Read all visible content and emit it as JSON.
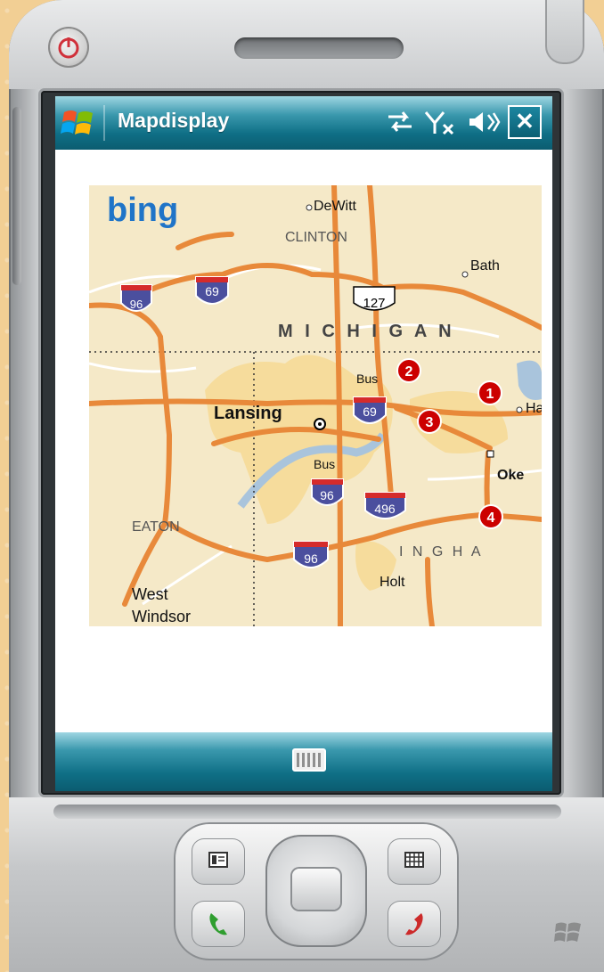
{
  "window": {
    "title": "Mapdisplay",
    "close_label": "✕"
  },
  "status_icons": [
    "connectivity-icon",
    "signal-off-icon",
    "volume-icon"
  ],
  "map": {
    "brand": "bing",
    "labels": {
      "dewitt": "DeWitt",
      "clinton": "CLINTON",
      "bath": "Bath",
      "michigan": "M I C H I G A N",
      "lansing": "Lansing",
      "bus1": "Bus",
      "bus2": "Bus",
      "okemos": "Oke",
      "ha": "Ha",
      "eaton": "EATON",
      "ingham": "I N G H A",
      "holt": "Holt",
      "west": "West",
      "windsor": "Windsor"
    },
    "shields": {
      "i96_west": "96",
      "i69_west": "69",
      "us127": "127",
      "i69_east": "69",
      "i96_bus": "96",
      "i496": "496",
      "i96_south": "96"
    },
    "markers": [
      "1",
      "2",
      "3",
      "4"
    ]
  },
  "colors": {
    "road": "#e8893a",
    "urban": "#f6dc9c",
    "water": "#a9c4dc",
    "marker": "#cc0000",
    "interstate": "#4b4f9e"
  }
}
